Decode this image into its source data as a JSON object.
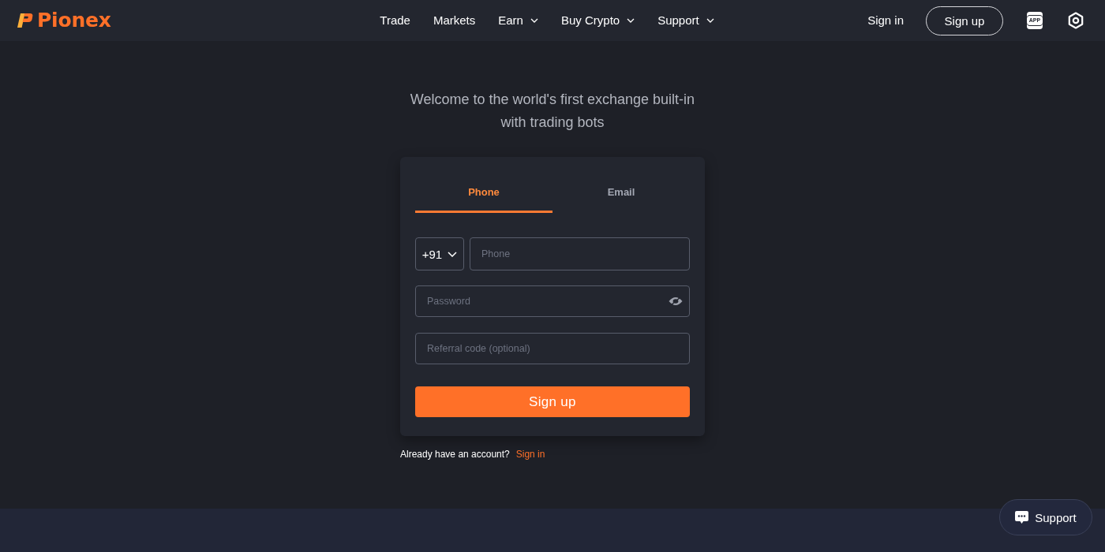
{
  "header": {
    "logo": "Pionex",
    "nav": [
      {
        "label": "Trade",
        "has_menu": false
      },
      {
        "label": "Markets",
        "has_menu": false
      },
      {
        "label": "Earn",
        "has_menu": true
      },
      {
        "label": "Buy Crypto",
        "has_menu": true
      },
      {
        "label": "Support",
        "has_menu": true
      }
    ],
    "sign_in": "Sign in",
    "sign_up": "Sign up",
    "app_badge": "APP"
  },
  "welcome": "Welcome to the world's first exchange built-in with trading bots",
  "form": {
    "tabs": [
      {
        "label": "Phone",
        "selected": true
      },
      {
        "label": "Email",
        "selected": false
      }
    ],
    "country_code": "+91",
    "phone": {
      "placeholder": "Phone"
    },
    "password": {
      "placeholder": "Password"
    },
    "referral": {
      "placeholder": "Referral code (optional)"
    },
    "submit": "Sign up"
  },
  "account_prompt": {
    "text": "Already have an account?",
    "link": "Sign in"
  },
  "support_button": "Support"
}
